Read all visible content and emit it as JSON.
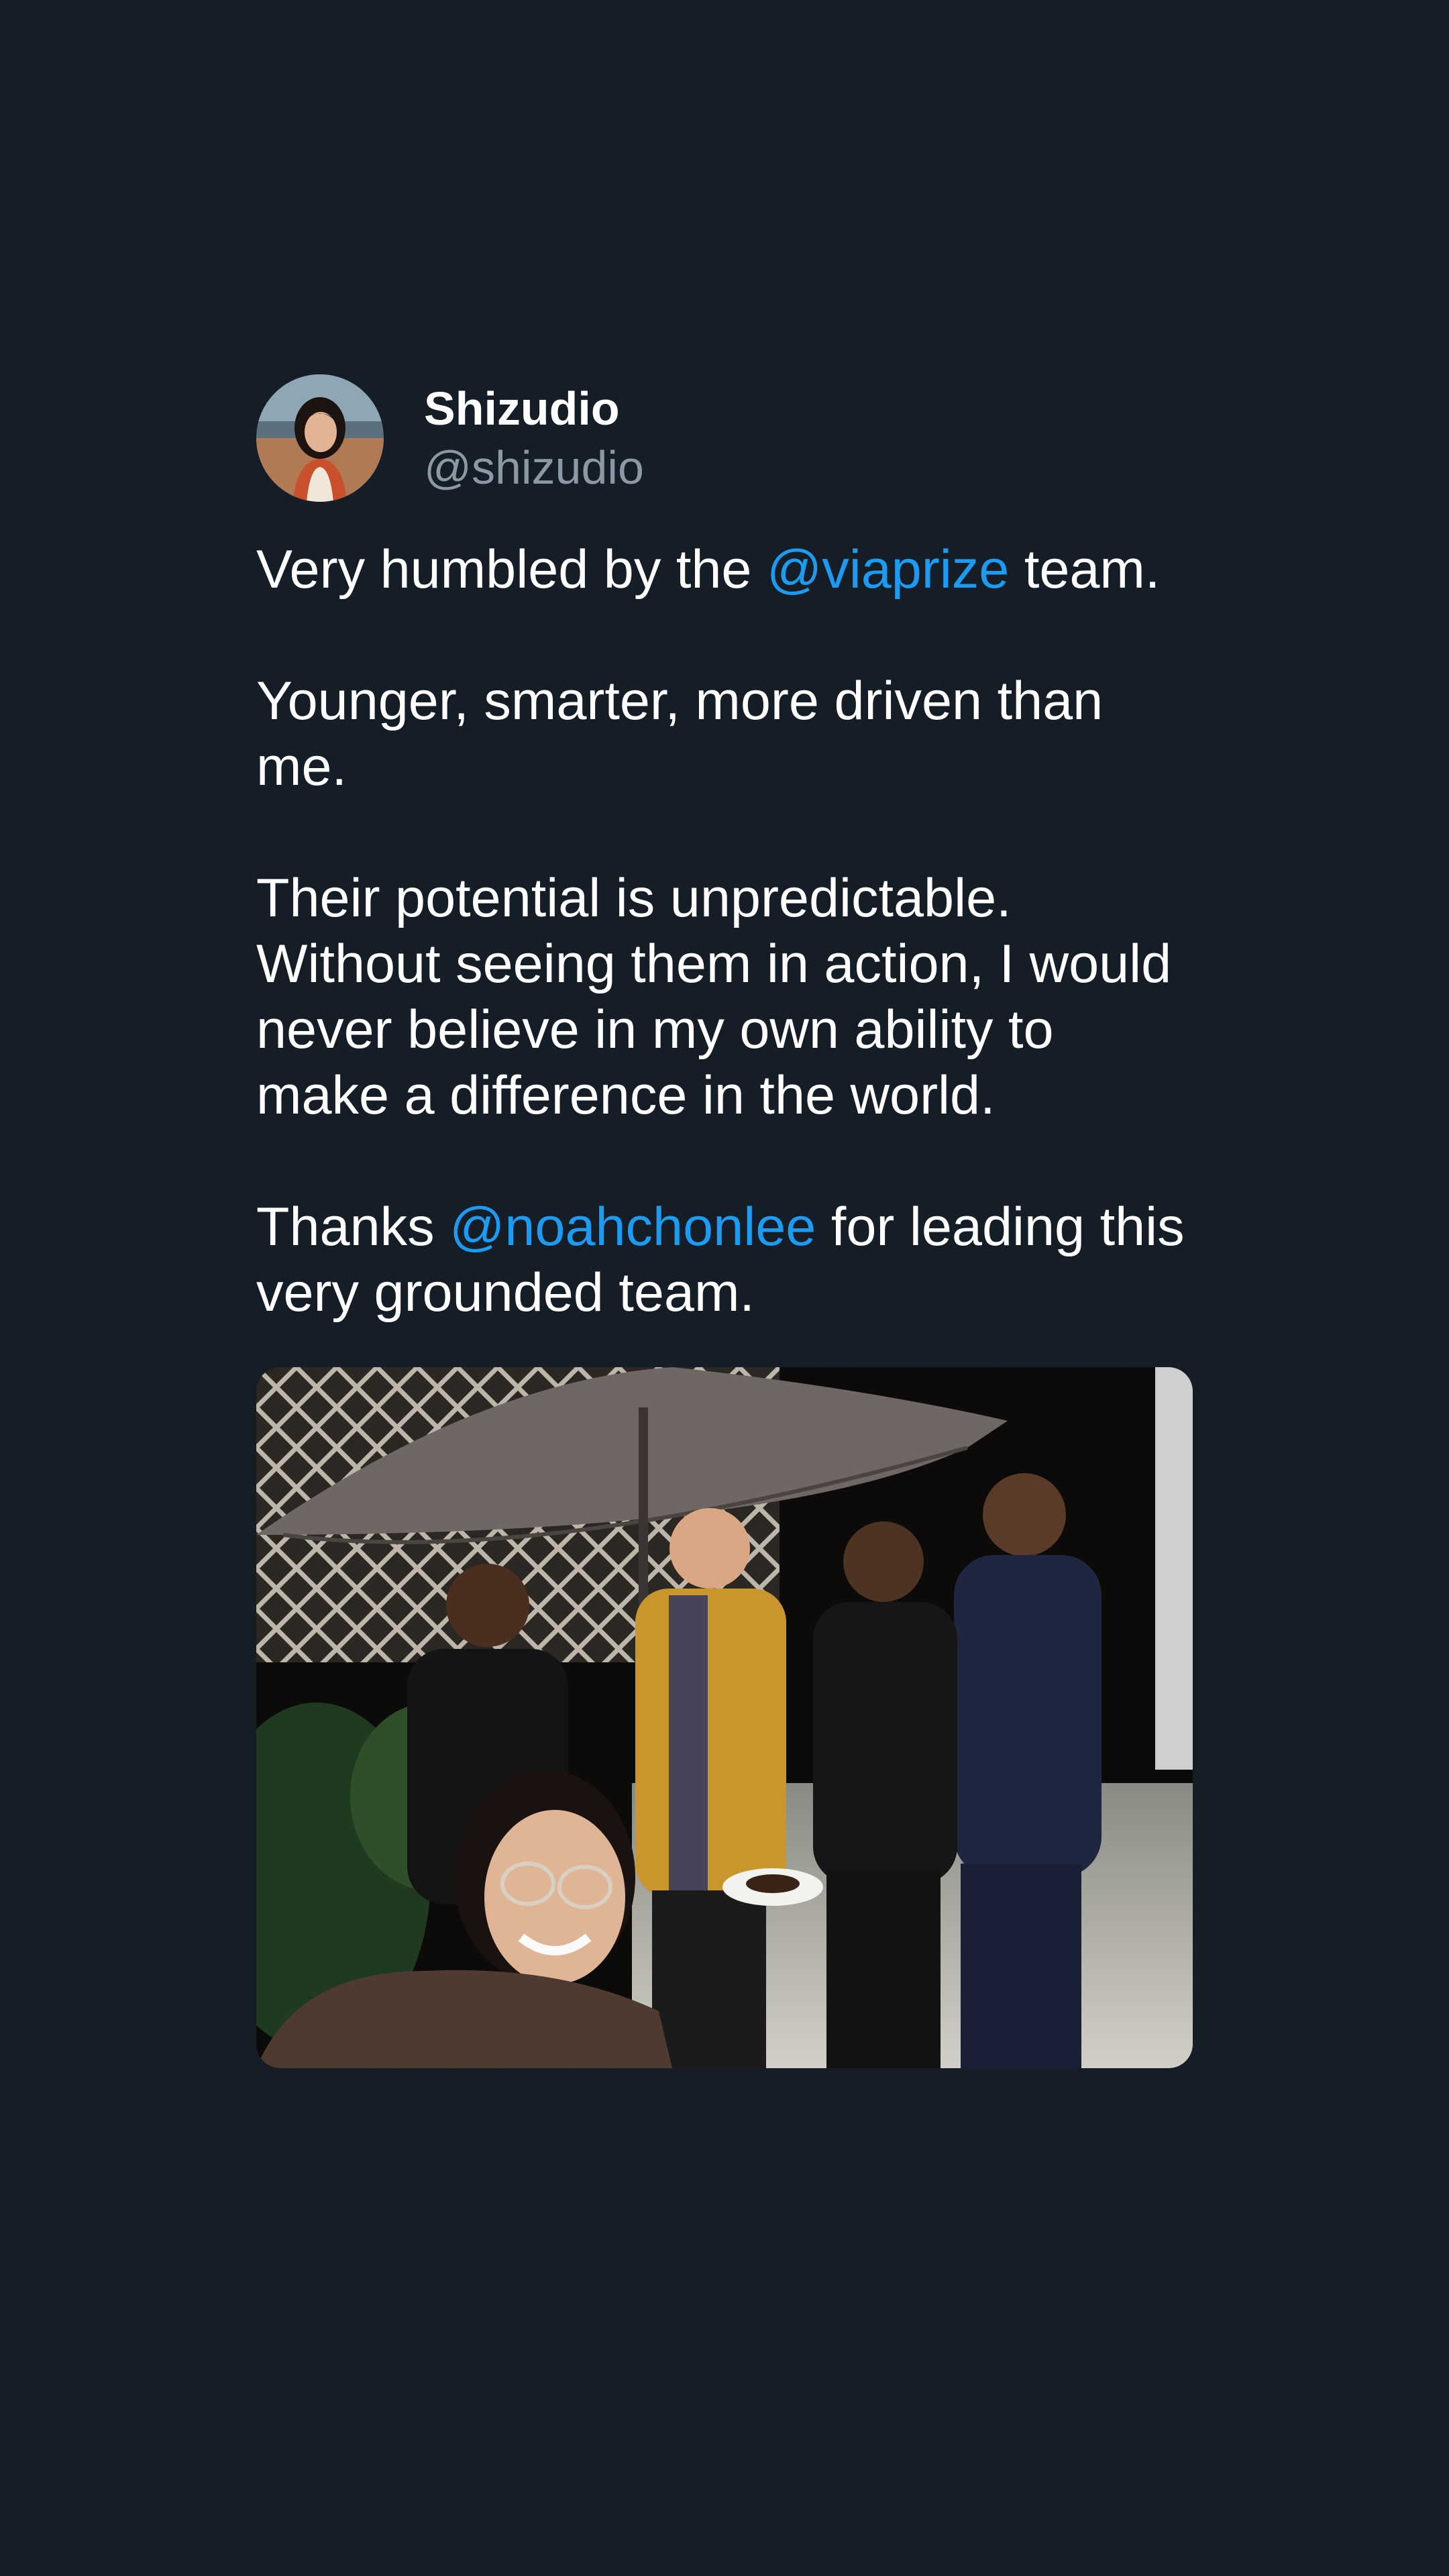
{
  "author": {
    "display_name": "Shizudio",
    "handle": "@shizudio",
    "avatar_icon": "profile-photo"
  },
  "tweet": {
    "p1_before": "Very humbled by the ",
    "p1_mention": "@viaprize",
    "p1_after": " team.",
    "p2": "Younger, smarter, more driven than me.",
    "p3": "Their potential is unpredictable. Without seeing them in action, I would never believe in my own ability to make a difference in the world.",
    "p4_before": "Thanks ",
    "p4_mention": "@noahchonlee",
    "p4_after": " for leading this very grounded team."
  },
  "media": {
    "description_icon": "group-photo"
  },
  "colors": {
    "background": "#151e27",
    "text": "#ffffff",
    "secondary_text": "#8b98a5",
    "mention": "#1d9bf0"
  }
}
